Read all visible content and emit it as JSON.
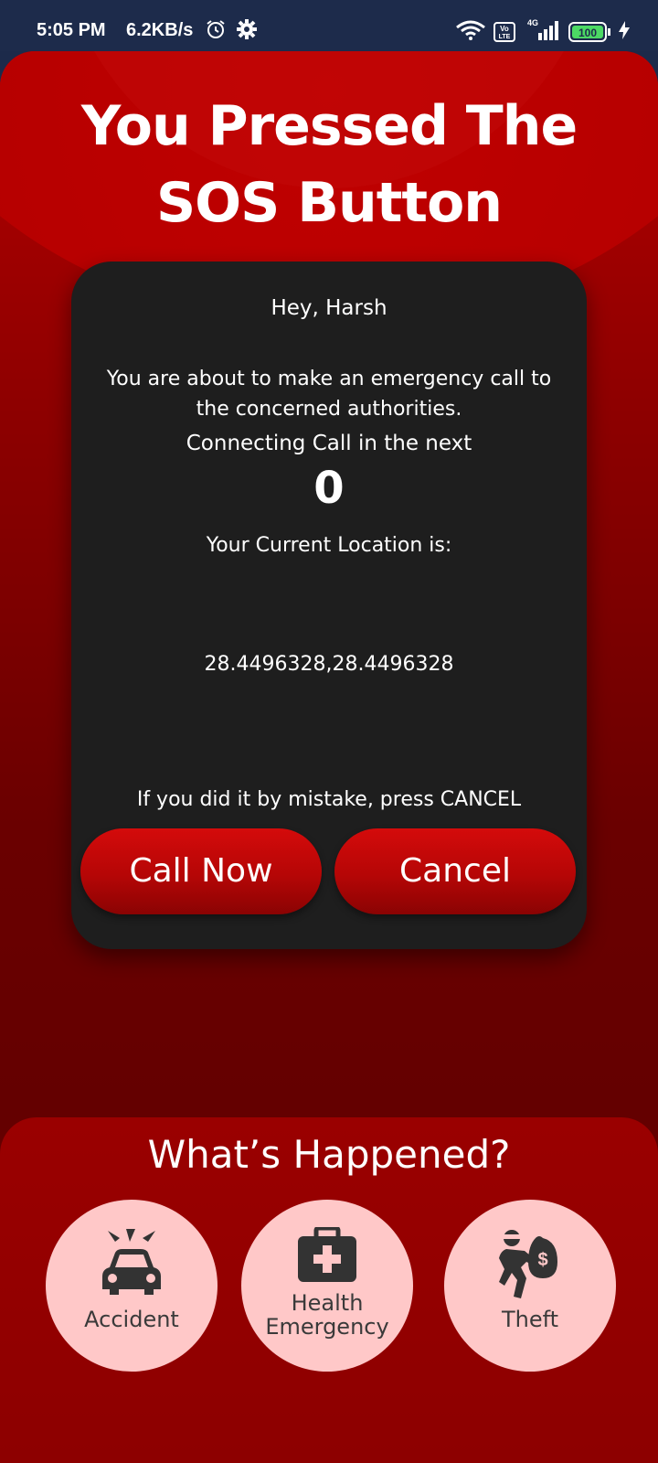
{
  "status_bar": {
    "time": "5:05 PM",
    "speed": "6.2KB/s",
    "volte_top": "Vo",
    "volte_bottom": "LTE",
    "network": "4G",
    "battery": "100"
  },
  "header": {
    "title": "You Pressed The SOS Button"
  },
  "dialog": {
    "greeting": "Hey, Harsh",
    "warning": "You are about to make an emergency call to the concerned authorities.",
    "connecting": "Connecting Call in the next",
    "countdown": "0",
    "location_label": "Your Current Location is:",
    "location_value": "28.4496328,28.4496328",
    "mistake_note": "If you did it by mistake, press CANCEL",
    "call_button": "Call Now",
    "cancel_button": "Cancel"
  },
  "incident": {
    "title": "What’s Happened?",
    "options": [
      {
        "label": "Accident",
        "icon": "car-crash-icon"
      },
      {
        "label_line1": "Health",
        "label_line2": "Emergency",
        "icon": "first-aid-kit-icon"
      },
      {
        "label": "Theft",
        "icon": "thief-icon"
      }
    ]
  },
  "colors": {
    "accent_red": "#b30000",
    "card_bg": "#1e1e1e",
    "option_bg": "#ffc8c8",
    "status_bar_bg": "#1d2b4b"
  }
}
